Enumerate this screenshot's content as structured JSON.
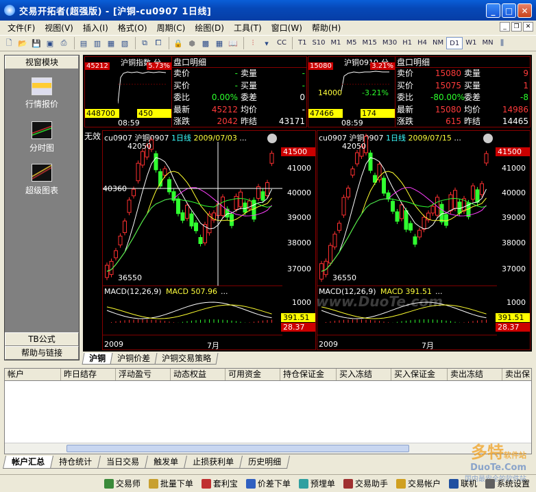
{
  "window": {
    "title": "交易开拓者(超强版) - [沪铜-cu0907 1日线]"
  },
  "menu": [
    "文件(F)",
    "视图(V)",
    "插入(I)",
    "格式(O)",
    "周期(C)",
    "绘图(D)",
    "工具(T)",
    "窗口(W)",
    "帮助(H)"
  ],
  "toolbar": {
    "periods": [
      "CC",
      "T1",
      "S10",
      "M1",
      "M5",
      "M15",
      "M30",
      "H1",
      "H4",
      "NM",
      "D1",
      "W1",
      "MN"
    ],
    "active_period": "D1"
  },
  "left_panel": {
    "header": "视窗模块",
    "items": [
      {
        "label": "行情报价",
        "icon": "quote-board-icon"
      },
      {
        "label": "分时图",
        "icon": "timeshare-chart-icon"
      },
      {
        "label": "超级图表",
        "icon": "super-chart-icon"
      }
    ],
    "buttons": [
      "TB公式",
      "帮助与链接"
    ]
  },
  "quote_left": {
    "mini_title": "沪铜指数-分",
    "mini_tags": [
      "45212",
      "5.73%"
    ],
    "mini_bottom": [
      "448700",
      "450"
    ],
    "mini_time": "08:59",
    "panel_title": "盘口明细",
    "rows": [
      [
        "卖价",
        "-",
        "卖量",
        "-"
      ],
      [
        "买价",
        "-",
        "买量",
        "-"
      ],
      [
        "委比",
        "0.00%",
        "委差",
        "0"
      ],
      [
        "最新",
        "45212",
        "均价",
        "-"
      ],
      [
        "涨跌",
        "2042",
        "昨结",
        "43171"
      ]
    ]
  },
  "quote_right": {
    "mini_title": "沪铜0910-分",
    "mini_tags": [
      "15080",
      "3.21%"
    ],
    "mini_mid": [
      "14000",
      "-3.21%"
    ],
    "mini_bottom": [
      "47466",
      "174"
    ],
    "mini_time": "08:59",
    "panel_title": "盘口明细",
    "rows": [
      [
        "卖价",
        "15080",
        "卖量",
        "9"
      ],
      [
        "买价",
        "15075",
        "买量",
        "1"
      ],
      [
        "委比",
        "-80.00%",
        "委差",
        "-8"
      ],
      [
        "最新",
        "15080",
        "均价",
        "14986"
      ],
      [
        "涨跌",
        "615",
        "昨结",
        "14465"
      ]
    ]
  },
  "wuxiao": "无效",
  "charts": [
    {
      "head_a": "cu0907 沪铜0907",
      "head_b": "1日线",
      "head_c": "2009/07/03",
      "head_dots": "...",
      "high_label": "42050",
      "low_label": "36550",
      "cross_label": "40360",
      "top_tag": "41500",
      "prices": [
        "41000",
        "40000",
        "39000",
        "38000",
        "37000"
      ],
      "macd_label": "MACD(12,26,9)",
      "macd_value": "MACD 507.96",
      "macd_dots": "...",
      "macd_scale": "1000",
      "macd_tag_1": "391.51",
      "macd_tag_2": "28.37",
      "x_labels": [
        "2009",
        "7月"
      ]
    },
    {
      "head_a": "cu0907 沪铜0907",
      "head_b": "1日线",
      "head_c": "2009/07/15",
      "head_dots": "...",
      "high_label": "42050",
      "low_label": "36550",
      "top_tag": "41500",
      "prices": [
        "41000",
        "40000",
        "39000",
        "38000",
        "37000"
      ],
      "macd_label": "MACD(12,26,9)",
      "macd_value": "MACD 391.51",
      "macd_dots": "...",
      "macd_scale": "1000",
      "macd_tag_1": "391.51",
      "macd_tag_2": "28.37",
      "x_labels": [
        "2009",
        "7月"
      ]
    }
  ],
  "chart_tabs": [
    "沪铜",
    "沪铜价差",
    "沪铜交易策略"
  ],
  "account_table": {
    "columns": [
      "帐户",
      "昨日结存",
      "浮动盈亏",
      "动态权益",
      "可用资金",
      "持仓保证金",
      "买入冻结",
      "买入保证金",
      "卖出冻结",
      "卖出保"
    ]
  },
  "bottom_tabs": [
    "帐户汇总",
    "持仓统计",
    "当日交易",
    "触发单",
    "止损获利单",
    "历史明细"
  ],
  "taskbar": [
    "交易师",
    "批量下单",
    "套利宝",
    "价差下单",
    "预埋单",
    "交易助手",
    "交易帐户",
    "联机",
    "系统设置"
  ],
  "watermark": {
    "brand": "多特",
    "brand_sub": "软件站",
    "url": "DuoTe.Com",
    "slogan": "国内最安全的软件站",
    "center": "www.DuoTe.com"
  }
}
